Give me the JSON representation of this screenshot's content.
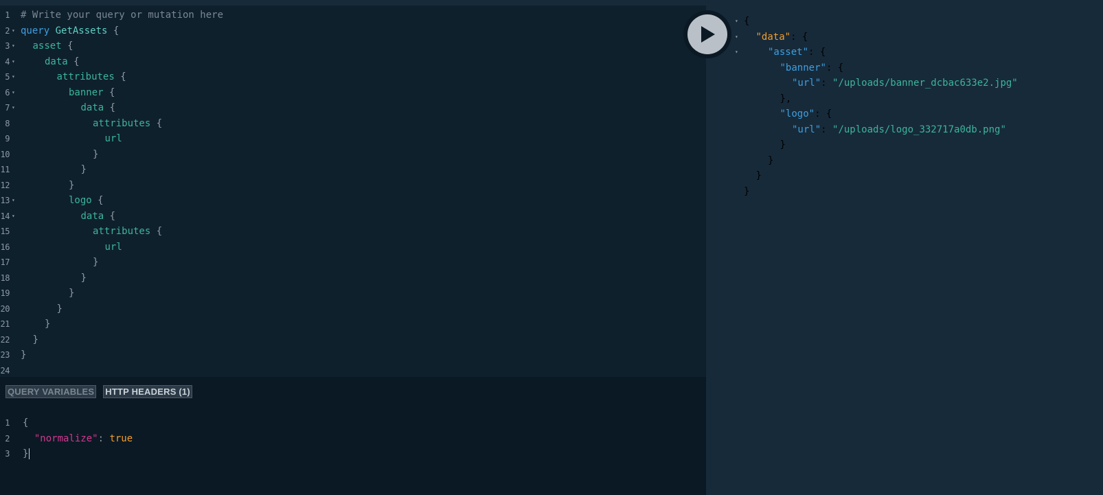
{
  "query_editor": {
    "lines": [
      {
        "n": "1",
        "fold": false,
        "indent": 0,
        "tokens": [
          {
            "c": "comment",
            "t": "# Write your query or mutation here"
          }
        ]
      },
      {
        "n": "2",
        "fold": true,
        "indent": 0,
        "tokens": [
          {
            "c": "keyword",
            "t": "query"
          },
          {
            "c": "def",
            "t": " GetAssets"
          },
          {
            "c": "punc",
            "t": " {"
          }
        ]
      },
      {
        "n": "3",
        "fold": true,
        "indent": 1,
        "tokens": [
          {
            "c": "field",
            "t": "asset"
          },
          {
            "c": "punc",
            "t": " {"
          }
        ]
      },
      {
        "n": "4",
        "fold": true,
        "indent": 2,
        "tokens": [
          {
            "c": "field",
            "t": "data"
          },
          {
            "c": "punc",
            "t": " {"
          }
        ]
      },
      {
        "n": "5",
        "fold": true,
        "indent": 3,
        "tokens": [
          {
            "c": "field",
            "t": "attributes"
          },
          {
            "c": "punc",
            "t": " {"
          }
        ]
      },
      {
        "n": "6",
        "fold": true,
        "indent": 4,
        "tokens": [
          {
            "c": "field",
            "t": "banner"
          },
          {
            "c": "punc",
            "t": " {"
          }
        ]
      },
      {
        "n": "7",
        "fold": true,
        "indent": 5,
        "tokens": [
          {
            "c": "field",
            "t": "data"
          },
          {
            "c": "punc",
            "t": " {"
          }
        ]
      },
      {
        "n": "8",
        "fold": false,
        "indent": 6,
        "tokens": [
          {
            "c": "field",
            "t": "attributes"
          },
          {
            "c": "punc",
            "t": " {"
          }
        ]
      },
      {
        "n": "9",
        "fold": false,
        "indent": 7,
        "tokens": [
          {
            "c": "field",
            "t": "url"
          }
        ]
      },
      {
        "n": "10",
        "fold": false,
        "indent": 6,
        "tokens": [
          {
            "c": "punc",
            "t": "}"
          }
        ]
      },
      {
        "n": "11",
        "fold": false,
        "indent": 5,
        "tokens": [
          {
            "c": "punc",
            "t": "}"
          }
        ]
      },
      {
        "n": "12",
        "fold": false,
        "indent": 4,
        "tokens": [
          {
            "c": "punc",
            "t": "}"
          }
        ]
      },
      {
        "n": "13",
        "fold": true,
        "indent": 4,
        "tokens": [
          {
            "c": "field",
            "t": "logo"
          },
          {
            "c": "punc",
            "t": " {"
          }
        ]
      },
      {
        "n": "14",
        "fold": true,
        "indent": 5,
        "tokens": [
          {
            "c": "field",
            "t": "data"
          },
          {
            "c": "punc",
            "t": " {"
          }
        ]
      },
      {
        "n": "15",
        "fold": false,
        "indent": 6,
        "tokens": [
          {
            "c": "field",
            "t": "attributes"
          },
          {
            "c": "punc",
            "t": " {"
          }
        ]
      },
      {
        "n": "16",
        "fold": false,
        "indent": 7,
        "tokens": [
          {
            "c": "field",
            "t": "url"
          }
        ]
      },
      {
        "n": "17",
        "fold": false,
        "indent": 6,
        "tokens": [
          {
            "c": "punc",
            "t": "}"
          }
        ]
      },
      {
        "n": "18",
        "fold": false,
        "indent": 5,
        "tokens": [
          {
            "c": "punc",
            "t": "}"
          }
        ]
      },
      {
        "n": "19",
        "fold": false,
        "indent": 4,
        "tokens": [
          {
            "c": "punc",
            "t": "}"
          }
        ]
      },
      {
        "n": "20",
        "fold": false,
        "indent": 3,
        "tokens": [
          {
            "c": "punc",
            "t": "}"
          }
        ]
      },
      {
        "n": "21",
        "fold": false,
        "indent": 2,
        "tokens": [
          {
            "c": "punc",
            "t": "}"
          }
        ]
      },
      {
        "n": "22",
        "fold": false,
        "indent": 1,
        "tokens": [
          {
            "c": "punc",
            "t": "}"
          }
        ]
      },
      {
        "n": "23",
        "fold": false,
        "indent": 0,
        "tokens": [
          {
            "c": "punc",
            "t": "}"
          }
        ]
      },
      {
        "n": "24",
        "fold": false,
        "indent": 0,
        "tokens": []
      }
    ]
  },
  "bottom_tabs": {
    "query_variables": "QUERY VARIABLES",
    "http_headers": "HTTP HEADERS (1)"
  },
  "headers_editor": {
    "lines": [
      {
        "n": "1",
        "tokens": [
          {
            "c": "punc",
            "t": "{"
          }
        ]
      },
      {
        "n": "2",
        "tokens": [
          {
            "c": "punc",
            "t": "  "
          },
          {
            "c": "prop",
            "t": "\"normalize\""
          },
          {
            "c": "punc",
            "t": ": "
          },
          {
            "c": "bool",
            "t": "true"
          }
        ]
      },
      {
        "n": "3",
        "tokens": [
          {
            "c": "punc",
            "t": "}"
          }
        ],
        "cursor": true
      }
    ]
  },
  "result_viewer": {
    "lines": [
      {
        "fold": true,
        "indent": 0,
        "tokens": [
          {
            "c": "punc",
            "t": "{"
          }
        ]
      },
      {
        "fold": true,
        "indent": 1,
        "tokens": [
          {
            "c": "key-orange",
            "t": "\"data\""
          },
          {
            "c": "punc",
            "t": ": {"
          }
        ]
      },
      {
        "fold": true,
        "indent": 2,
        "tokens": [
          {
            "c": "key-blue",
            "t": "\"asset\""
          },
          {
            "c": "punc",
            "t": ": {"
          }
        ]
      },
      {
        "fold": false,
        "indent": 3,
        "tokens": [
          {
            "c": "key-blue",
            "t": "\"banner\""
          },
          {
            "c": "punc",
            "t": ": {"
          }
        ]
      },
      {
        "fold": false,
        "indent": 4,
        "tokens": [
          {
            "c": "key-blue",
            "t": "\"url\""
          },
          {
            "c": "punc",
            "t": ": "
          },
          {
            "c": "str",
            "t": "\"/uploads/banner_dcbac633e2.jpg\""
          }
        ]
      },
      {
        "fold": false,
        "indent": 3,
        "tokens": [
          {
            "c": "punc",
            "t": "},"
          }
        ]
      },
      {
        "fold": false,
        "indent": 3,
        "tokens": [
          {
            "c": "key-blue",
            "t": "\"logo\""
          },
          {
            "c": "punc",
            "t": ": {"
          }
        ]
      },
      {
        "fold": false,
        "indent": 4,
        "tokens": [
          {
            "c": "key-blue",
            "t": "\"url\""
          },
          {
            "c": "punc",
            "t": ": "
          },
          {
            "c": "str",
            "t": "\"/uploads/logo_332717a0db.png\""
          }
        ]
      },
      {
        "fold": false,
        "indent": 3,
        "tokens": [
          {
            "c": "punc",
            "t": "}"
          }
        ]
      },
      {
        "fold": false,
        "indent": 2,
        "tokens": [
          {
            "c": "punc",
            "t": "}"
          }
        ]
      },
      {
        "fold": false,
        "indent": 1,
        "tokens": [
          {
            "c": "punc",
            "t": "}"
          }
        ]
      },
      {
        "fold": false,
        "indent": 0,
        "tokens": [
          {
            "c": "punc",
            "t": "}"
          }
        ]
      }
    ]
  },
  "run_button": {
    "icon": "play-icon"
  },
  "fold_icon": "triangle-down-icon"
}
